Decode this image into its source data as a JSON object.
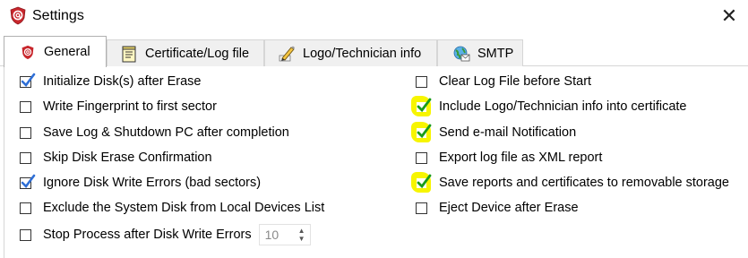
{
  "window": {
    "title": "Settings",
    "close_glyph": "✕",
    "app_icon": "shield-at-icon"
  },
  "tabs": [
    {
      "label": "General",
      "icon": "shield-at-icon",
      "active": true
    },
    {
      "label": "Certificate/Log file",
      "icon": "notepad-icon",
      "active": false
    },
    {
      "label": "Logo/Technician info",
      "icon": "pen-icon",
      "active": false
    },
    {
      "label": "SMTP",
      "icon": "globe-mail-icon",
      "active": false
    }
  ],
  "left_options": [
    {
      "label": "Initialize Disk(s) after Erase",
      "checked": true,
      "highlighted": false
    },
    {
      "label": "Write Fingerprint to first sector",
      "checked": false,
      "highlighted": false
    },
    {
      "label": "Save Log & Shutdown PC after completion",
      "checked": false,
      "highlighted": false
    },
    {
      "label": "Skip Disk Erase Confirmation",
      "checked": false,
      "highlighted": false
    },
    {
      "label": "Ignore Disk Write Errors (bad sectors)",
      "checked": true,
      "highlighted": false
    },
    {
      "label": "Exclude the System Disk from Local Devices List",
      "checked": false,
      "highlighted": false
    },
    {
      "label": "Stop Process after Disk Write Errors",
      "checked": false,
      "highlighted": false
    }
  ],
  "right_options": [
    {
      "label": "Clear Log File before Start",
      "checked": false,
      "highlighted": false
    },
    {
      "label": "Include Logo/Technician info into certificate",
      "checked": true,
      "highlighted": true
    },
    {
      "label": "Send e-mail Notification",
      "checked": true,
      "highlighted": true
    },
    {
      "label": "Export log file as XML report",
      "checked": false,
      "highlighted": false
    },
    {
      "label": "Save reports and certificates to removable storage",
      "checked": true,
      "highlighted": true
    },
    {
      "label": "Eject Device after Erase",
      "checked": false,
      "highlighted": false
    }
  ],
  "stop_errors_spin": {
    "value": "10",
    "up_glyph": "▲",
    "down_glyph": "▼"
  },
  "colors": {
    "check_blue": "#2f6fd6",
    "check_green": "#1a9c1a",
    "highlight_yellow": "#f7f500",
    "brand_red": "#c8272d"
  }
}
